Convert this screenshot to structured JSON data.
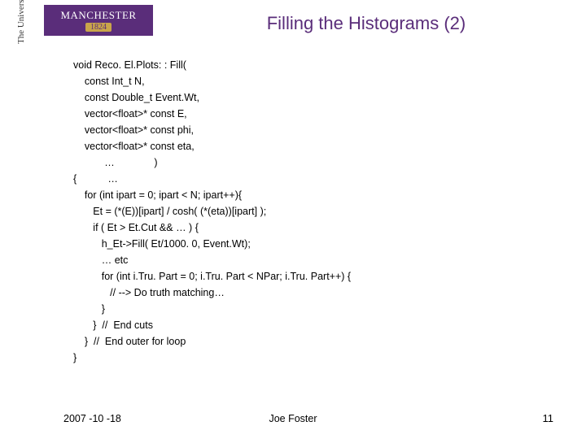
{
  "logo": {
    "name": "MANCHESTER",
    "year": "1824",
    "subtitle": "The University\nof Manchester"
  },
  "title": "Filling the Histograms (2)",
  "code": {
    "l01": "void Reco. El.Plots: : Fill(",
    "l02": "    const Int_t N,",
    "l03": "    const Double_t Event.Wt,",
    "l04": "    vector<float>* const E,",
    "l05": "    vector<float>* const phi,",
    "l06": "    vector<float>* const eta,",
    "l07": "           …              )",
    "l08": "{           …",
    "l09": "    for (int ipart = 0; ipart < N; ipart++){",
    "l10": "       Et = (*(E))[ipart] / cosh( (*(eta))[ipart] );",
    "l11": "       if ( Et > Et.Cut && … ) {",
    "l12": "          h_Et->Fill( Et/1000. 0, Event.Wt);",
    "l13": "          … etc",
    "l14": "          for (int i.Tru. Part = 0; i.Tru. Part < NPar; i.Tru. Part++) {",
    "l15": "             // --> Do truth matching…",
    "l16": "          }",
    "l17": "       }  //  End cuts",
    "l18": "    }  //  End outer for loop",
    "l19": "}"
  },
  "footer": {
    "date": "2007 -10 -18",
    "author": "Joe Foster",
    "page": "11"
  }
}
